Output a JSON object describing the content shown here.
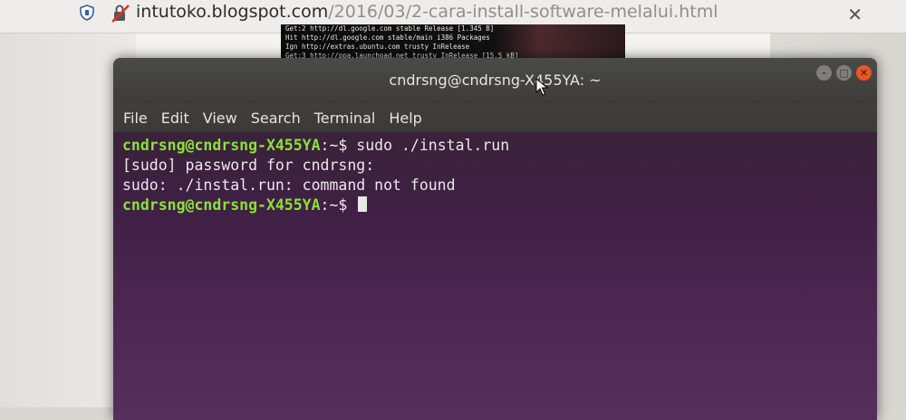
{
  "browser": {
    "url_host": "intutoko.blogspot.com",
    "url_path": "/2016/03/2-cara-install-software-melalui.html",
    "icons": [
      "shield-icon",
      "no-lock-icon",
      "close-icon"
    ]
  },
  "background_image": {
    "lines": [
      "Get:2 http://dl.google.com stable Release [1.345 B]",
      "Hit http://dl.google.com stable/main i386 Packages",
      "Ign http://extras.ubuntu.com trusty InRelease",
      "Get:3 http://ppa.launchpad.net trusty InRelease [15,5 kB]"
    ]
  },
  "terminal": {
    "title": "cndrsng@cndrsng-X455YA: ~",
    "menu": [
      "File",
      "Edit",
      "View",
      "Search",
      "Terminal",
      "Help"
    ],
    "prompt_user": "cndrsng@cndrsng-X455YA",
    "prompt_path": ":~",
    "prompt_symbol": "$",
    "lines": [
      {
        "type": "prompt",
        "command": " sudo ./instal.run"
      },
      {
        "type": "output",
        "text": "[sudo] password for cndrsng:"
      },
      {
        "type": "output",
        "text": "sudo: ./instal.run: command not found"
      },
      {
        "type": "prompt",
        "command": " "
      }
    ],
    "colors": {
      "prompt_user": "#8ae234",
      "background": "#4c2753",
      "close_button": "#ea5522"
    }
  }
}
